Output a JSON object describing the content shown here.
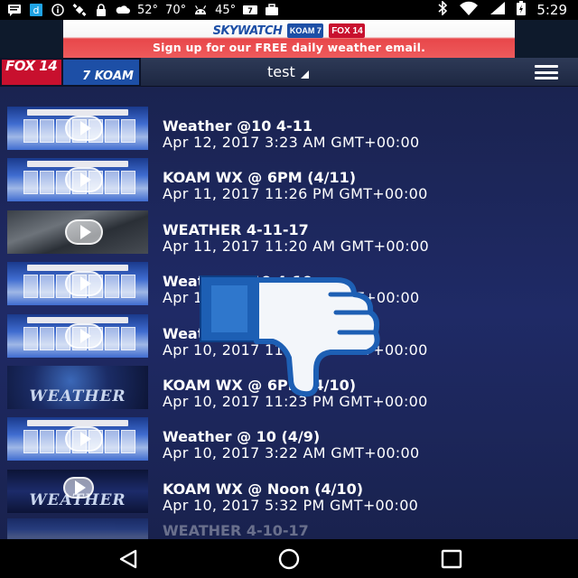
{
  "status_bar": {
    "temp_1": "52°",
    "temp_2": "70°",
    "temp_3": "45°",
    "time": "5:29",
    "icons": [
      "message-icon",
      "app-icon",
      "info-icon",
      "satellite-icon",
      "lock-icon",
      "weather-icon",
      "android-icon",
      "koam-icon",
      "briefcase-icon",
      "bluetooth-icon",
      "wifi-icon",
      "signal-icon",
      "battery-icon"
    ]
  },
  "ad": {
    "brand": "SKYWATCH",
    "logo_1": "KOAM 7",
    "logo_2": "FOX 14",
    "tagline": "Sign up for our FREE daily weather email."
  },
  "app_bar": {
    "logo_fox": "FOX 14",
    "logo_koam": "7 KOAM",
    "title": "test"
  },
  "videos": [
    {
      "title": "Weather @10 4-11",
      "date": "Apr 12, 2017 3:23 AM GMT+00:00",
      "thumb": "forecast"
    },
    {
      "title": "KOAM WX @ 6PM (4/11)",
      "date": "Apr 11, 2017 11:26 PM GMT+00:00",
      "thumb": "forecast"
    },
    {
      "title": "WEATHER 4-11-17",
      "date": "Apr 11, 2017 11:20 AM GMT+00:00",
      "thumb": "dark"
    },
    {
      "title": "Weather @10 4-10",
      "date": "Apr 11, 2017 3:27 AM GMT+00:00",
      "thumb": "forecast"
    },
    {
      "title": "Weather @ 6PM (4/10)",
      "date": "Apr 10, 2017 11:30 PM GMT+00:00",
      "thumb": "forecast"
    },
    {
      "title": "KOAM WX @ 6PM (4/10)",
      "date": "Apr 10, 2017 11:23 PM GMT+00:00",
      "thumb": "weather",
      "thumb_label": "WEATHER"
    },
    {
      "title": "Weather @ 10 (4/9)",
      "date": "Apr 10, 2017 3:22 AM GMT+00:00",
      "thumb": "forecast"
    },
    {
      "title": "KOAM WX @ Noon (4/10)",
      "date": "Apr 10, 2017 5:32 PM GMT+00:00",
      "thumb": "skywatch",
      "thumb_label": "WEATHER"
    },
    {
      "title": "WEATHER 4-10-17",
      "date": "",
      "thumb": "forecast"
    }
  ],
  "overlay": {
    "icon": "thumbs-down-icon"
  },
  "nav": {
    "back": "back-icon",
    "home": "home-icon",
    "recents": "recents-icon"
  },
  "colors": {
    "accent_blue": "#1d5fb4",
    "fox_red": "#c8102e",
    "list_bg": "#1f2a66"
  }
}
